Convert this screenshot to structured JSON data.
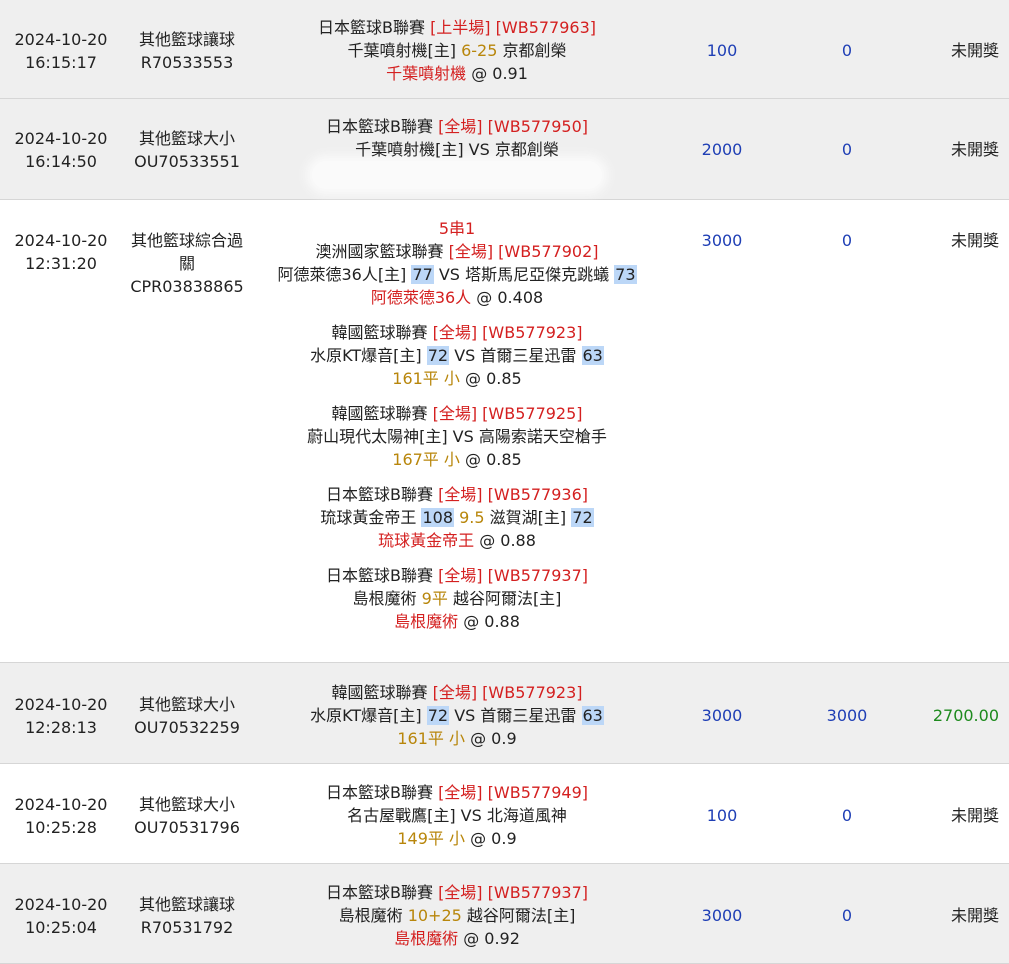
{
  "rows": [
    {
      "date": "2024-10-20",
      "time": "16:15:17",
      "type": "其他籃球讓球",
      "ticket": "R70533553",
      "league": "日本籃球B聯賽",
      "period": "[上半場]",
      "code": "[WB577963]",
      "m_home": "千葉噴射機[主]",
      "m_line": "6-25",
      "m_away": "京都創榮",
      "pick": "千葉噴射機",
      "odds": "@ 0.91",
      "amount": "100",
      "valid": "0",
      "result": "未開獎"
    },
    {
      "date": "2024-10-20",
      "time": "16:14:50",
      "type": "其他籃球大小",
      "ticket": "OU70533551",
      "league": "日本籃球B聯賽",
      "period": "[全場]",
      "code": "[WB577950]",
      "match": "千葉噴射機[主] VS 京都創榮",
      "amount": "2000",
      "valid": "0",
      "result": "未開獎"
    },
    {
      "date": "2024-10-20",
      "time": "12:31:20",
      "type_1": "其他籃球綜合過",
      "type_2": "關",
      "ticket": "CPR03838865",
      "parlay": "5串1",
      "legs": [
        {
          "league": "澳洲國家籃球聯賽",
          "period": "[全場]",
          "code": "[WB577902]",
          "home": "阿德萊德36人[主]",
          "home_score": "77",
          "vs": "VS",
          "away": "塔斯馬尼亞傑克跳蟻",
          "away_score": "73",
          "pick": "阿德萊德36人",
          "odds": "@ 0.408"
        },
        {
          "league": "韓國籃球聯賽",
          "period": "[全場]",
          "code": "[WB577923]",
          "home": "水原KT爆音[主]",
          "home_score": "72",
          "vs": "VS",
          "away": "首爾三星迅雷",
          "away_score": "63",
          "pick": "161平 小",
          "odds": "@ 0.85"
        },
        {
          "league": "韓國籃球聯賽",
          "period": "[全場]",
          "code": "[WB577925]",
          "match": "蔚山現代太陽神[主] VS 高陽索諾天空槍手",
          "pick": "167平 小",
          "odds": "@ 0.85"
        },
        {
          "league": "日本籃球B聯賽",
          "period": "[全場]",
          "code": "[WB577936]",
          "team_a": "琉球黃金帝王",
          "score_a": "108",
          "line": "9.5",
          "team_b": "滋賀湖[主]",
          "score_b": "72",
          "pick": "琉球黃金帝王",
          "odds": "@ 0.88"
        },
        {
          "league": "日本籃球B聯賽",
          "period": "[全場]",
          "code": "[WB577937]",
          "team_a": "島根魔術",
          "line": "9平",
          "team_b": "越谷阿爾法[主]",
          "pick": "島根魔術",
          "odds": "@ 0.88"
        }
      ],
      "amount": "3000",
      "valid": "0",
      "result": "未開獎"
    },
    {
      "date": "2024-10-20",
      "time": "12:28:13",
      "type": "其他籃球大小",
      "ticket": "OU70532259",
      "league": "韓國籃球聯賽",
      "period": "[全場]",
      "code": "[WB577923]",
      "home": "水原KT爆音[主]",
      "home_score": "72",
      "vs": "VS",
      "away": "首爾三星迅雷",
      "away_score": "63",
      "pick": "161平 小",
      "odds": "@ 0.9",
      "amount": "3000",
      "valid": "3000",
      "result": "2700.00"
    },
    {
      "date": "2024-10-20",
      "time": "10:25:28",
      "type": "其他籃球大小",
      "ticket": "OU70531796",
      "league": "日本籃球B聯賽",
      "period": "[全場]",
      "code": "[WB577949]",
      "match": "名古屋戰鷹[主] VS 北海道風神",
      "pick": "149平 小",
      "odds": "@ 0.9",
      "amount": "100",
      "valid": "0",
      "result": "未開獎"
    },
    {
      "date": "2024-10-20",
      "time": "10:25:04",
      "type": "其他籃球讓球",
      "ticket": "R70531792",
      "league": "日本籃球B聯賽",
      "period": "[全場]",
      "code": "[WB577937]",
      "team_a": "島根魔術",
      "line": "10+25",
      "team_b": "越谷阿爾法[主]",
      "pick": "島根魔術",
      "odds": "@ 0.92",
      "amount": "3000",
      "valid": "0",
      "result": "未開獎"
    }
  ],
  "colors": {
    "red": "#d42020",
    "gold": "#b8860b",
    "blue": "#1f3fb5",
    "green": "#1d8a1d",
    "highlight": "#bcd7f7",
    "row_alt": "#efefef"
  }
}
